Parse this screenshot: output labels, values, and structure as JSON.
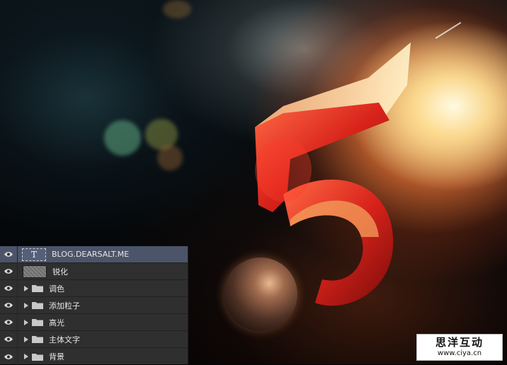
{
  "layers": [
    {
      "name": "BLOG.DEARSALT.ME",
      "type": "text",
      "selected": true,
      "visible": true,
      "thumb_glyph": "T"
    },
    {
      "name": "锐化",
      "type": "pixel",
      "selected": false,
      "visible": true
    },
    {
      "name": "调色",
      "type": "group",
      "selected": false,
      "visible": true
    },
    {
      "name": "添加粒子",
      "type": "group",
      "selected": false,
      "visible": true
    },
    {
      "name": "高光",
      "type": "group",
      "selected": false,
      "visible": true
    },
    {
      "name": "主体文字",
      "type": "group",
      "selected": false,
      "visible": true
    },
    {
      "name": "背景",
      "type": "group",
      "selected": false,
      "visible": true
    }
  ],
  "watermark": {
    "title": "思洋互动",
    "url": "www.ciya.cn"
  },
  "colors": {
    "panel": "#2f2f2f",
    "selected_row": "#4c5469",
    "text": "#e6e6e6"
  }
}
